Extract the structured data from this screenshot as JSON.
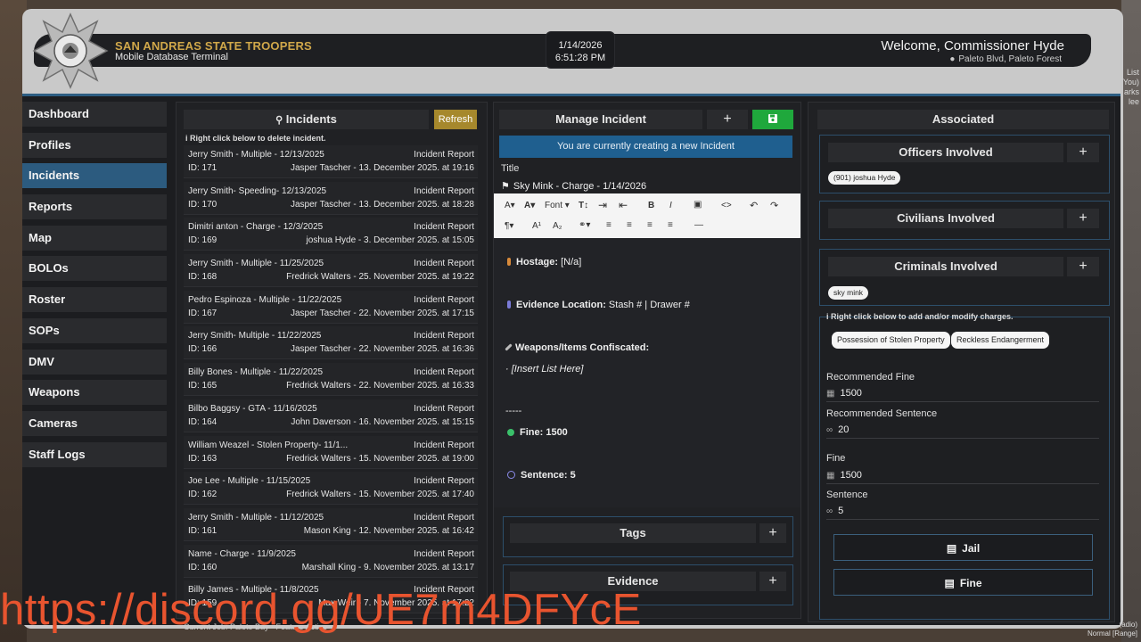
{
  "background": {
    "right_edge_text": [
      "List",
      "You)",
      "arks",
      "lee"
    ],
    "bottom_right_text": [
      "(adio)",
      "Normal [Range]"
    ]
  },
  "header": {
    "agency_title": "SAN ANDREAS STATE TROOPERS",
    "agency_subtitle": "Mobile Database Terminal",
    "date": "1/14/2026",
    "time": "6:51:28 PM",
    "welcome": "Welcome, Commissioner Hyde",
    "location": "Paleto Blvd, Paleto Forest",
    "colors": {
      "agency_title": "#d1a84a"
    }
  },
  "sidebar": {
    "items": [
      {
        "label": "Dashboard"
      },
      {
        "label": "Profiles"
      },
      {
        "label": "Incidents",
        "active": true
      },
      {
        "label": "Reports"
      },
      {
        "label": "Map"
      },
      {
        "label": "BOLOs"
      },
      {
        "label": "Roster"
      },
      {
        "label": "SOPs"
      },
      {
        "label": "DMV"
      },
      {
        "label": "Weapons"
      },
      {
        "label": "Cameras"
      },
      {
        "label": "Staff Logs"
      }
    ],
    "active_color": "#2c5b7f"
  },
  "incidents": {
    "title": "Incidents",
    "refresh_label": "Refresh",
    "hint": "Right click below to delete incident.",
    "rows": [
      {
        "title": "Jerry Smith - Multiple - 12/13/2025",
        "type": "Incident Report",
        "id": "ID: 171",
        "meta": "Jasper Tascher - 13. December 2025. at 19:16"
      },
      {
        "title": "Jerry Smith- Speeding- 12/13/2025",
        "type": "Incident Report",
        "id": "ID: 170",
        "meta": "Jasper Tascher - 13. December 2025. at 18:28"
      },
      {
        "title": "Dimitri anton - Charge - 12/3/2025",
        "type": "Incident Report",
        "id": "ID: 169",
        "meta": "joshua Hyde - 3. December 2025. at 15:05"
      },
      {
        "title": "Jerry Smith - Multiple - 11/25/2025",
        "type": "Incident Report",
        "id": "ID: 168",
        "meta": "Fredrick Walters - 25. November 2025. at 19:22"
      },
      {
        "title": "Pedro Espinoza - Multiple - 11/22/2025",
        "type": "Incident Report",
        "id": "ID: 167",
        "meta": "Jasper Tascher - 22. November 2025. at 17:15"
      },
      {
        "title": "Jerry Smith- Multiple - 11/22/2025",
        "type": "Incident Report",
        "id": "ID: 166",
        "meta": "Jasper Tascher - 22. November 2025. at 16:36"
      },
      {
        "title": "Billy Bones - Multiple - 11/22/2025",
        "type": "Incident Report",
        "id": "ID: 165",
        "meta": "Fredrick Walters - 22. November 2025. at 16:33"
      },
      {
        "title": "Bilbo Baggsy - GTA - 11/16/2025",
        "type": "Incident Report",
        "id": "ID: 164",
        "meta": "John Daverson - 16. November 2025. at 15:15"
      },
      {
        "title": "William Weazel - Stolen Property- 11/1...",
        "type": "Incident Report",
        "id": "ID: 163",
        "meta": "Fredrick Walters - 15. November 2025. at 19:00"
      },
      {
        "title": "Joe Lee - Multiple - 11/15/2025",
        "type": "Incident Report",
        "id": "ID: 162",
        "meta": "Fredrick Walters - 15. November 2025. at 17:40"
      },
      {
        "title": "Jerry Smith - Multiple - 11/12/2025",
        "type": "Incident Report",
        "id": "ID: 161",
        "meta": "Mason King - 12. November 2025. at 16:42"
      },
      {
        "title": "Name - Charge - 11/9/2025",
        "type": "Incident Report",
        "id": "ID: 160",
        "meta": "Marshall King - 9. November 2025. at 13:17"
      },
      {
        "title": "Billy James - Multiple - 11/8/2025",
        "type": "Incident Report",
        "id": "ID: 159",
        "meta": "Max Weir - 7. November 2025. at 17:22"
      }
    ]
  },
  "manage": {
    "title": "Manage Incident",
    "add_label": "+",
    "notice": "You are currently creating a new Incident",
    "title_label": "Title",
    "title_value": "Sky Mink  - Charge - 1/14/2026",
    "toolbar": {
      "font_label": "Font"
    },
    "editor": {
      "hostage_label": "Hostage:",
      "hostage_value": "[N/a]",
      "evidence_label": "Evidence Location:",
      "evidence_value": "Stash # | Drawer #",
      "weapons_label": "Weapons/Items Confiscated:",
      "weapons_value": "· [Insert List Here]",
      "divider": "-----",
      "fine_label": "Fine: 1500",
      "sentence_label": "Sentence: 5"
    },
    "tags_label": "Tags",
    "evidence_box_label": "Evidence",
    "accent_colors": {
      "notice": "#1f5f8f",
      "save": "#1fa83c"
    }
  },
  "associated": {
    "title": "Associated",
    "officers_label": "Officers Involved",
    "officers": [
      "(901) joshua Hyde"
    ],
    "civilians_label": "Civilians Involved",
    "criminals_label": "Criminals Involved",
    "criminals": [
      "sky mink"
    ],
    "charges_hint": "Right click below to add and/or modify charges.",
    "charges": [
      "Possession of Stolen Property",
      "Reckless Endangerment"
    ],
    "recommended_fine_label": "Recommended Fine",
    "recommended_fine": "1500",
    "recommended_sentence_label": "Recommended Sentence",
    "recommended_sentence": "20",
    "fine_label": "Fine",
    "fine": "1500",
    "sentence_label": "Sentence",
    "sentence": "5",
    "jail_button": "Jail",
    "fine_button": "Fine"
  },
  "overlay": {
    "watermark": "https://discord.gg/UE7m4DFYcE",
    "bottom_text": "Current Job: Paleto Bay - Feature Active"
  }
}
